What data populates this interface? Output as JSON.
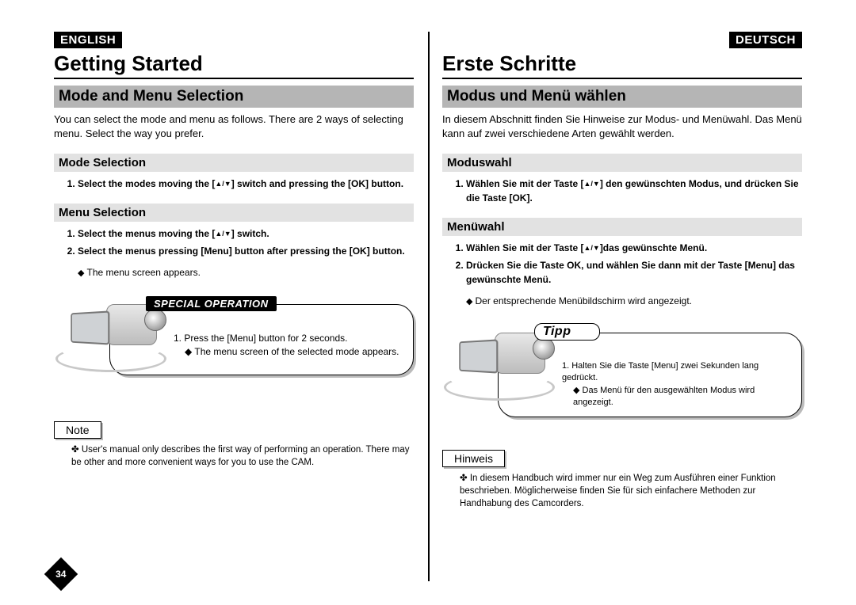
{
  "left": {
    "lang": "ENGLISH",
    "chapter": "Getting Started",
    "section": "Mode and Menu Selection",
    "intro": "You can select the mode and menu as follows. There are 2 ways of selecting menu. Select the way you prefer.",
    "sub1": "Mode Selection",
    "sub1_step1a": "Select the modes moving the [",
    "sub1_step1b": "] switch and pressing the [OK] button.",
    "sub2": "Menu Selection",
    "sub2_step1a": "Select the menus moving the [",
    "sub2_step1b": "] switch.",
    "sub2_step2": "Select the menus pressing [Menu] button after pressing the [OK] button.",
    "sub2_bullet": "The menu screen appears.",
    "callout_label": "SPECIAL OPERATION",
    "callout_step": "1. Press the [Menu] button for 2 seconds.",
    "callout_bullet": "The menu screen of the selected mode appears.",
    "note_label": "Note",
    "note_text": "User's manual only describes the first way of performing an operation. There may be other and more convenient ways for you to use the CAM.",
    "page_num": "34"
  },
  "right": {
    "lang": "DEUTSCH",
    "chapter": "Erste Schritte",
    "section": "Modus und Menü wählen",
    "intro": "In diesem Abschnitt finden Sie Hinweise zur Modus- und Menüwahl. Das Menü kann auf zwei verschiedene Arten gewählt werden.",
    "sub1": "Moduswahl",
    "sub1_step1a": "Wählen Sie mit der Taste [",
    "sub1_step1b": "] den gewünschten Modus, und drücken Sie die Taste [OK].",
    "sub2": "Menüwahl",
    "sub2_step1a": "Wählen Sie mit der Taste [",
    "sub2_step1b": "]das gewünschte Menü.",
    "sub2_step2": "Drücken Sie die Taste OK, und wählen Sie dann mit der Taste [Menu] das gewünschte Menü.",
    "sub2_bullet": "Der entsprechende Menübildschirm wird angezeigt.",
    "callout_label": "Tipp",
    "callout_step": "1. Halten Sie die Taste [Menu] zwei Sekunden lang  gedrückt.",
    "callout_bullet": "Das Menü für den ausgewählten Modus wird angezeigt.",
    "note_label": "Hinweis",
    "note_text": "In diesem Handbuch wird immer nur ein Weg zum Ausführen einer Funktion beschrieben. Möglicherweise finden Sie für sich einfachere Methoden zur Handhabung des Camcorders."
  }
}
